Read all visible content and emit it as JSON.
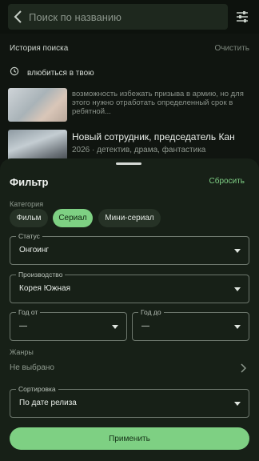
{
  "search": {
    "placeholder": "Поиск по названию"
  },
  "history": {
    "title": "История поиска",
    "clear_label": "Очистить",
    "items": [
      {
        "label": "влюбиться в твою"
      }
    ]
  },
  "results": [
    {
      "description": "возможность избежать призыва в армию, но для этого нужно отработать определенный срок в ребятной..."
    },
    {
      "title": "Новый сотрудник, председатель Кан",
      "meta": "2026 · детектив, драма, фантастика"
    }
  ],
  "filter": {
    "title": "Фильтр",
    "reset_label": "Сбросить",
    "category_label": "Категория",
    "categories": [
      {
        "label": "Фильм",
        "active": false
      },
      {
        "label": "Сериал",
        "active": true
      },
      {
        "label": "Мини-сериал",
        "active": false
      }
    ],
    "status": {
      "label": "Статус",
      "value": "Онгоинг"
    },
    "production": {
      "label": "Производство",
      "value": "Корея Южная"
    },
    "year_from": {
      "label": "Год от",
      "value": "—"
    },
    "year_to": {
      "label": "Год до",
      "value": "—"
    },
    "genres": {
      "label": "Жанры",
      "value": "Не выбрано"
    },
    "sort": {
      "label": "Сортировка",
      "value": "По дате релиза"
    },
    "apply_label": "Применить"
  },
  "colors": {
    "accent": "#7ed083",
    "background": "#101510",
    "sheet": "#172017"
  }
}
